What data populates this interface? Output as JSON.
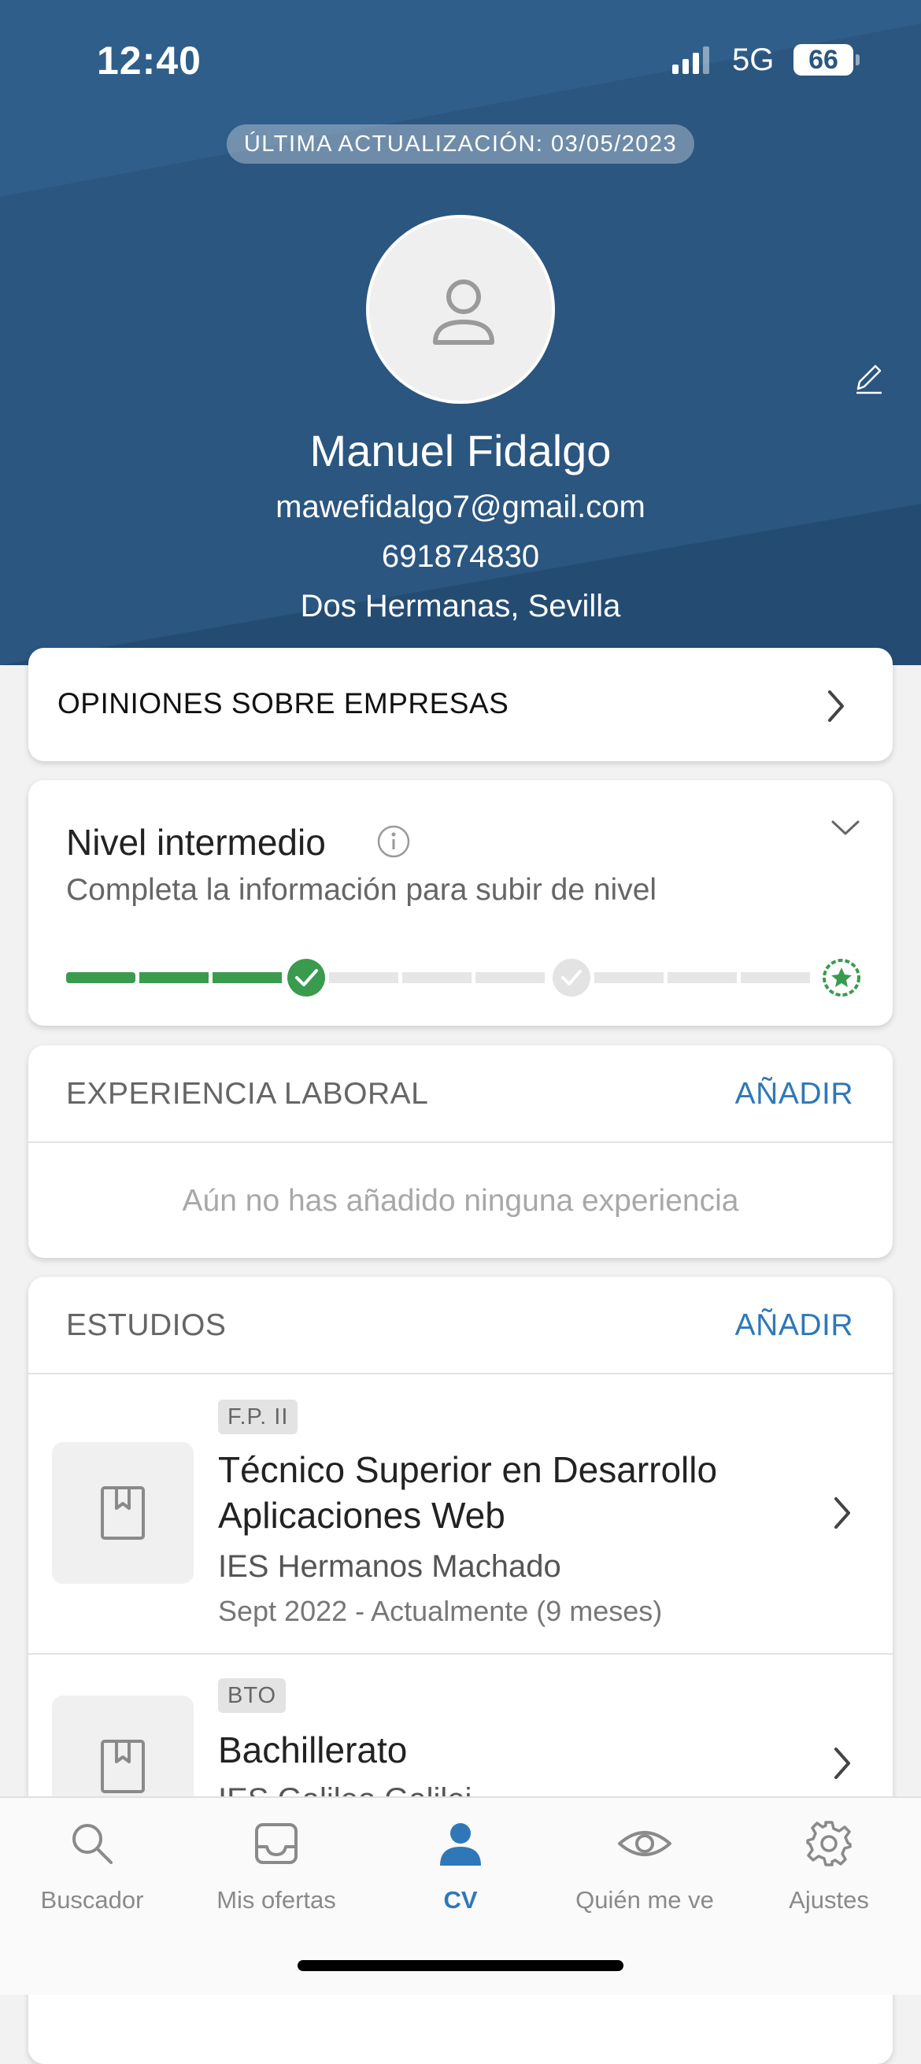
{
  "status": {
    "time": "12:40",
    "network": "5G",
    "battery": "66"
  },
  "profile": {
    "update_badge": "ÚLTIMA ACTUALIZACIÓN: 03/05/2023",
    "name": "Manuel Fidalgo",
    "email": "mawefidalgo7@gmail.com",
    "phone": "691874830",
    "location": "Dos Hermanas, Sevilla"
  },
  "opiniones": {
    "label": "OPINIONES SOBRE EMPRESAS"
  },
  "nivel": {
    "title": "Nivel intermedio",
    "subtitle": "Completa la información para subir de nivel",
    "progress_segments_filled": 3,
    "progress_segments_total": 9
  },
  "experiencia": {
    "header": "EXPERIENCIA LABORAL",
    "add_label": "AÑADIR",
    "empty_text": "Aún no has añadido ninguna experiencia"
  },
  "estudios": {
    "header": "ESTUDIOS",
    "add_label": "AÑADIR",
    "items": [
      {
        "tag": "F.P. II",
        "title": "Técnico Superior en Desarrollo Aplicaciones Web",
        "school": "IES Hermanos Machado",
        "dates": "Sept 2022 - Actualmente (9 meses)"
      },
      {
        "tag": "BTO",
        "title": "Bachillerato",
        "school": "IES Galileo Galilei"
      }
    ]
  },
  "tabs": [
    {
      "label": "Buscador",
      "icon": "search-icon"
    },
    {
      "label": "Mis ofertas",
      "icon": "inbox-icon"
    },
    {
      "label": "CV",
      "icon": "person-icon",
      "active": true
    },
    {
      "label": "Quién me ve",
      "icon": "eye-icon"
    },
    {
      "label": "Ajustes",
      "icon": "gear-icon"
    }
  ],
  "colors": {
    "header_bg": "#2a5680",
    "accent": "#2f78b8",
    "progress_green": "#3a9b4f"
  }
}
